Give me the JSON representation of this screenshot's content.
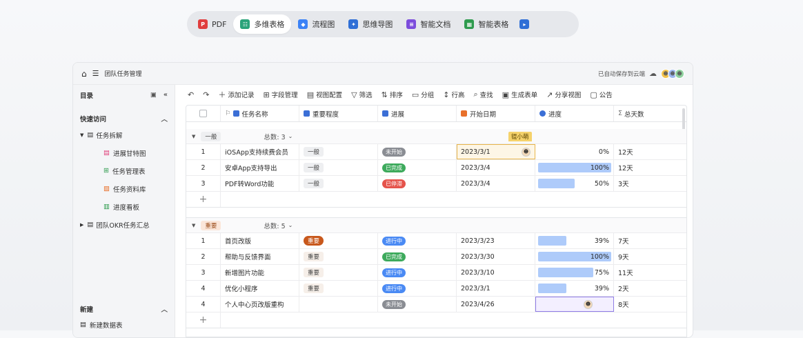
{
  "tabs": [
    {
      "label": "PDF",
      "icon": "pdf-icon",
      "color": "#e03e3e",
      "glyph": "P",
      "active": false
    },
    {
      "label": "多维表格",
      "icon": "table-icon",
      "color": "#2aa37a",
      "glyph": "☷",
      "active": true
    },
    {
      "label": "流程图",
      "icon": "flowchart-icon",
      "color": "#3b82f6",
      "glyph": "◆",
      "active": false
    },
    {
      "label": "思维导图",
      "icon": "mindmap-icon",
      "color": "#2f6fd6",
      "glyph": "✦",
      "active": false
    },
    {
      "label": "智能文档",
      "icon": "document-icon",
      "color": "#7c4ddc",
      "glyph": "≡",
      "active": false
    },
    {
      "label": "智能表格",
      "icon": "spreadsheet-icon",
      "color": "#2e9b4e",
      "glyph": "▦",
      "active": false
    }
  ],
  "window": {
    "title": "团队任务管理",
    "save_status": "已自动保存到云端"
  },
  "sidebar": {
    "catalog_title": "目录",
    "quick_access": "快速访问",
    "folder1": "任务拆解",
    "items": [
      {
        "label": "进展甘特图",
        "icon": "gantt-icon",
        "color": "#e0407a"
      },
      {
        "label": "任务管理表",
        "icon": "grid-icon",
        "color": "#2e9b4e"
      },
      {
        "label": "任务资料库",
        "icon": "gallery-icon",
        "color": "#e8702a"
      },
      {
        "label": "进度看板",
        "icon": "kanban-icon",
        "color": "#2e9b4e"
      }
    ],
    "folder2": "团队OKR任务汇总",
    "new_section": "新建",
    "new_datasheet": "新建数据表"
  },
  "toolbar": {
    "add_record": "添加记录",
    "field_manage": "字段管理",
    "view_config": "视图配置",
    "filter": "筛选",
    "sort": "排序",
    "group": "分组",
    "row_height": "行高",
    "search": "查找",
    "form": "生成表单",
    "share": "分享视图",
    "notice": "公告"
  },
  "columns": {
    "name": "任务名称",
    "priority": "重要程度",
    "status": "进展",
    "start": "开始日期",
    "progress": "进度",
    "days": "总天数"
  },
  "group1": {
    "tag": "一般",
    "count_label": "总数: 3",
    "cursor_user": "锟小萌",
    "rows": [
      {
        "num": "1",
        "name": "iOSApp支持续费会员",
        "priority": "一般",
        "status": "未开始",
        "status_color": "#8a8d93",
        "date": "2023/3/1",
        "progress": "0%",
        "progress_value": 0,
        "days": "12天"
      },
      {
        "num": "2",
        "name": "安卓App支持导出",
        "priority": "一般",
        "status": "已完成",
        "status_color": "#3daa5c",
        "date": "2023/3/4",
        "progress": "100%",
        "progress_value": 1.0,
        "days": "12天"
      },
      {
        "num": "3",
        "name": "PDF转Word功能",
        "priority": "一般",
        "status": "已停滞",
        "status_color": "#e5534b",
        "date": "2023/3/4",
        "progress": "50%",
        "progress_value": 0.5,
        "days": "3天"
      }
    ]
  },
  "group2": {
    "tag": "重要",
    "count_label": "总数: 5",
    "rows": [
      {
        "num": "1",
        "name": "首页改版",
        "priority": "重要",
        "priority_strong": true,
        "status": "进行中",
        "status_color": "#4a8af4",
        "date": "2023/3/23",
        "progress": "39%",
        "progress_value": 0.39,
        "days": "7天"
      },
      {
        "num": "2",
        "name": "帮助与反馈界面",
        "priority": "重要",
        "status": "已完成",
        "status_color": "#3daa5c",
        "date": "2023/3/30",
        "progress": "100%",
        "progress_value": 1.0,
        "days": "9天"
      },
      {
        "num": "3",
        "name": "新增图片功能",
        "priority": "重要",
        "status": "进行中",
        "status_color": "#4a8af4",
        "date": "2023/3/10",
        "progress": "75%",
        "progress_value": 0.75,
        "days": "11天"
      },
      {
        "num": "4",
        "name": "优化小程序",
        "priority": "重要",
        "status": "进行中",
        "status_color": "#4a8af4",
        "date": "2023/3/1",
        "progress": "39%",
        "progress_value": 0.39,
        "days": "2天"
      },
      {
        "num": "4",
        "name": "个人中心页改版重构",
        "priority": "",
        "status": "未开始",
        "status_color": "#8a8d93",
        "date": "2023/4/26",
        "progress": "",
        "progress_value": 0,
        "days": "8天"
      }
    ]
  }
}
